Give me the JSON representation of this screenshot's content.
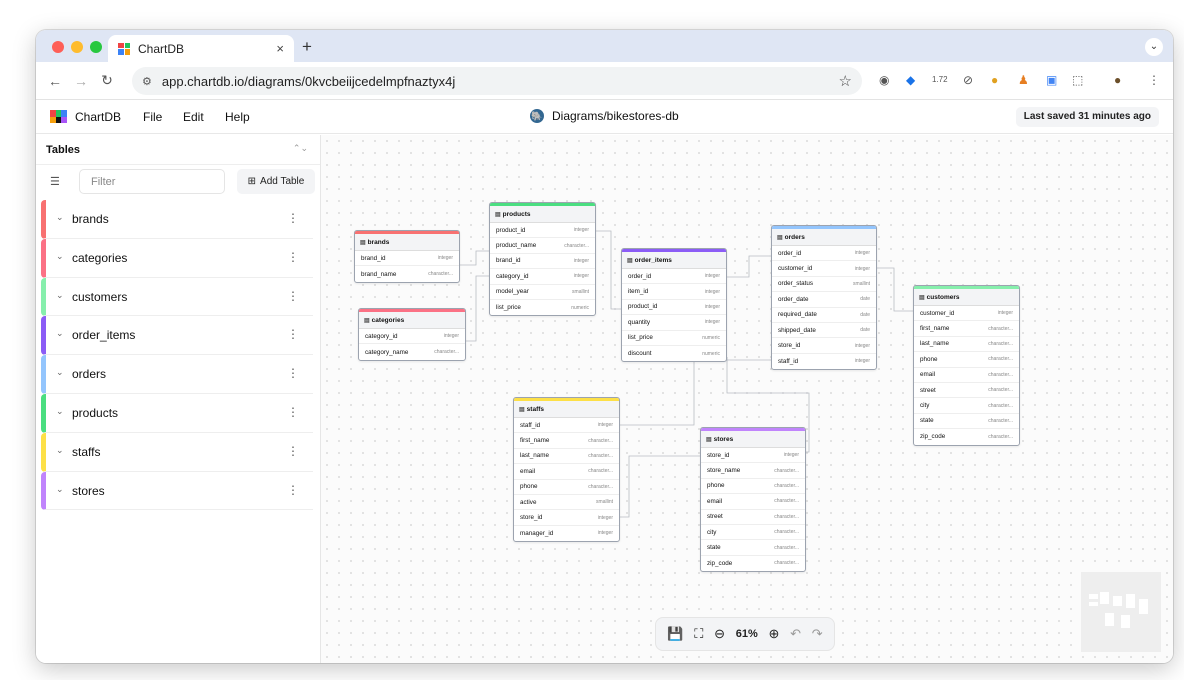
{
  "browser": {
    "tab_title": "ChartDB",
    "tab_close": "×",
    "new_tab": "+",
    "url": "app.chartdb.io/diagrams/0kvcbeiijcedelmpfnaztyx4j",
    "extension_badge": "1.72"
  },
  "app": {
    "name": "ChartDB",
    "menu": [
      "File",
      "Edit",
      "Help"
    ],
    "diagram_title": "Diagrams/bikestores-db",
    "last_saved": "Last saved 31 minutes ago"
  },
  "sidebar": {
    "title": "Tables",
    "filter_placeholder": "Filter",
    "add_table": "Add Table",
    "tables": [
      {
        "name": "brands",
        "color": "#f87171"
      },
      {
        "name": "categories",
        "color": "#fb7185"
      },
      {
        "name": "customers",
        "color": "#86efac"
      },
      {
        "name": "order_items",
        "color": "#8b5cf6"
      },
      {
        "name": "orders",
        "color": "#93c5fd"
      },
      {
        "name": "products",
        "color": "#4ade80"
      },
      {
        "name": "staffs",
        "color": "#fde047"
      },
      {
        "name": "stores",
        "color": "#c084fc"
      }
    ]
  },
  "diagram": {
    "tables": [
      {
        "name": "brands",
        "color": "#f87171",
        "fields": [
          {
            "name": "brand_id",
            "type": "integer"
          },
          {
            "name": "brand_name",
            "type": "character..."
          }
        ]
      },
      {
        "name": "categories",
        "color": "#fb7185",
        "fields": [
          {
            "name": "category_id",
            "type": "integer"
          },
          {
            "name": "category_name",
            "type": "character..."
          }
        ]
      },
      {
        "name": "products",
        "color": "#4ade80",
        "fields": [
          {
            "name": "product_id",
            "type": "integer"
          },
          {
            "name": "product_name",
            "type": "character..."
          },
          {
            "name": "brand_id",
            "type": "integer"
          },
          {
            "name": "category_id",
            "type": "integer"
          },
          {
            "name": "model_year",
            "type": "smallint"
          },
          {
            "name": "list_price",
            "type": "numeric"
          }
        ]
      },
      {
        "name": "order_items",
        "color": "#8b5cf6",
        "fields": [
          {
            "name": "order_id",
            "type": "integer"
          },
          {
            "name": "item_id",
            "type": "integer"
          },
          {
            "name": "product_id",
            "type": "integer"
          },
          {
            "name": "quantity",
            "type": "integer"
          },
          {
            "name": "list_price",
            "type": "numeric"
          },
          {
            "name": "discount",
            "type": "numeric"
          }
        ]
      },
      {
        "name": "orders",
        "color": "#93c5fd",
        "fields": [
          {
            "name": "order_id",
            "type": "integer"
          },
          {
            "name": "customer_id",
            "type": "integer"
          },
          {
            "name": "order_status",
            "type": "smallint"
          },
          {
            "name": "order_date",
            "type": "date"
          },
          {
            "name": "required_date",
            "type": "date"
          },
          {
            "name": "shipped_date",
            "type": "date"
          },
          {
            "name": "store_id",
            "type": "integer"
          },
          {
            "name": "staff_id",
            "type": "integer"
          }
        ]
      },
      {
        "name": "customers",
        "color": "#86efac",
        "fields": [
          {
            "name": "customer_id",
            "type": "integer"
          },
          {
            "name": "first_name",
            "type": "character..."
          },
          {
            "name": "last_name",
            "type": "character..."
          },
          {
            "name": "phone",
            "type": "character..."
          },
          {
            "name": "email",
            "type": "character..."
          },
          {
            "name": "street",
            "type": "character..."
          },
          {
            "name": "city",
            "type": "character..."
          },
          {
            "name": "state",
            "type": "character..."
          },
          {
            "name": "zip_code",
            "type": "character..."
          }
        ]
      },
      {
        "name": "staffs",
        "color": "#fde047",
        "fields": [
          {
            "name": "staff_id",
            "type": "integer"
          },
          {
            "name": "first_name",
            "type": "character..."
          },
          {
            "name": "last_name",
            "type": "character..."
          },
          {
            "name": "email",
            "type": "character..."
          },
          {
            "name": "phone",
            "type": "character..."
          },
          {
            "name": "active",
            "type": "smallint"
          },
          {
            "name": "store_id",
            "type": "integer"
          },
          {
            "name": "manager_id",
            "type": "integer"
          }
        ]
      },
      {
        "name": "stores",
        "color": "#c084fc",
        "fields": [
          {
            "name": "store_id",
            "type": "integer"
          },
          {
            "name": "store_name",
            "type": "character..."
          },
          {
            "name": "phone",
            "type": "character..."
          },
          {
            "name": "email",
            "type": "character..."
          },
          {
            "name": "street",
            "type": "character..."
          },
          {
            "name": "city",
            "type": "character..."
          },
          {
            "name": "state",
            "type": "character..."
          },
          {
            "name": "zip_code",
            "type": "character..."
          }
        ]
      }
    ],
    "zoom": "61%"
  }
}
